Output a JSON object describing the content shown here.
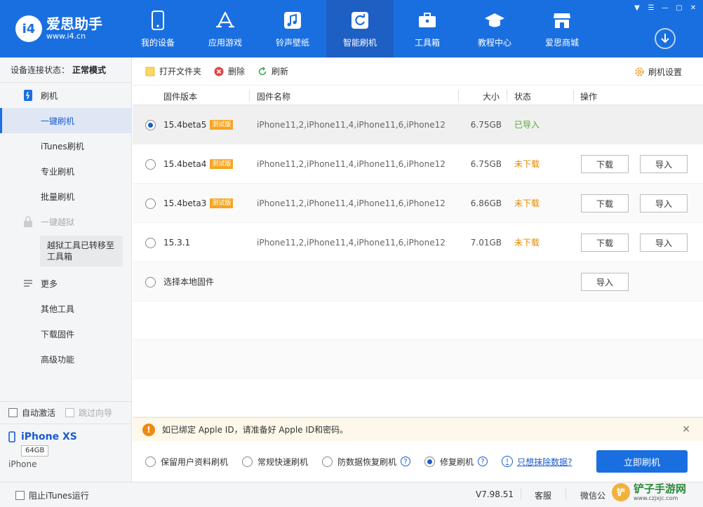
{
  "app": {
    "logo_mark": "i4",
    "logo_name": "爱思助手",
    "logo_url": "www.i4.cn"
  },
  "nav": [
    {
      "label": "我的设备",
      "icon": "phone-icon"
    },
    {
      "label": "应用游戏",
      "icon": "app-store-icon"
    },
    {
      "label": "铃声壁纸",
      "icon": "music-icon"
    },
    {
      "label": "智能刷机",
      "icon": "refresh-icon",
      "active": true
    },
    {
      "label": "工具箱",
      "icon": "toolbox-icon"
    },
    {
      "label": "教程中心",
      "icon": "graduation-cap-icon"
    },
    {
      "label": "爱思商城",
      "icon": "store-icon"
    }
  ],
  "sidebar": {
    "status_label": "设备连接状态：",
    "status_value": "正常模式",
    "flash_group": "刷机",
    "items": [
      "一键刷机",
      "iTunes刷机",
      "专业刷机",
      "批量刷机"
    ],
    "jailbreak_group": "一键越狱",
    "jailbreak_notice": "越狱工具已转移至工具箱",
    "more_group": "更多",
    "more_items": [
      "其他工具",
      "下载固件",
      "高级功能"
    ],
    "auto_activate": "自动激活",
    "skip_guide": "跳过向导",
    "device_name": "iPhone XS",
    "device_capacity": "64GB",
    "device_type": "iPhone"
  },
  "toolbar": {
    "open_folder": "打开文件夹",
    "delete": "删除",
    "refresh": "刷新",
    "settings": "刷机设置"
  },
  "table": {
    "headers": [
      "固件版本",
      "固件名称",
      "大小",
      "状态",
      "操作"
    ],
    "rows": [
      {
        "version": "15.4beta5",
        "tag": "测试版",
        "name": "iPhone11,2,iPhone11,4,iPhone11,6,iPhone12,...",
        "size": "6.75GB",
        "status": "已导入",
        "status_type": "ok",
        "selected": true
      },
      {
        "version": "15.4beta4",
        "tag": "测试版",
        "name": "iPhone11,2,iPhone11,4,iPhone11,6,iPhone12,...",
        "size": "6.75GB",
        "status": "未下载",
        "status_type": "nd"
      },
      {
        "version": "15.4beta3",
        "tag": "测试版",
        "name": "iPhone11,2,iPhone11,4,iPhone11,6,iPhone12,...",
        "size": "6.86GB",
        "status": "未下载",
        "status_type": "nd"
      },
      {
        "version": "15.3.1",
        "tag": "",
        "name": "iPhone11,2,iPhone11,4,iPhone11,6,iPhone12,...",
        "size": "7.01GB",
        "status": "未下载",
        "status_type": "nd"
      }
    ],
    "download_label": "下载",
    "import_label": "导入",
    "local_label": "选择本地固件"
  },
  "notice": {
    "text": "如已绑定 Apple ID，请准备好 Apple ID和密码。",
    "close": "×"
  },
  "modes": {
    "options": [
      "保留用户资料刷机",
      "常规快速刷机",
      "防数据恢复刷机",
      "修复刷机"
    ],
    "selected_index": 3,
    "erase_link": "只想抹除数据?",
    "flash_button": "立即刷机"
  },
  "statusbar": {
    "block_itunes": "阻止iTunes运行",
    "version": "V7.98.51",
    "service": "客服",
    "wechat": "微信公"
  },
  "watermark": {
    "text": "铲子手游网",
    "url": "www.czjxjc.com"
  },
  "colors": {
    "brand_blue": "#1a6fe0",
    "ok_green": "#52a934",
    "warn_orange": "#e68a00",
    "tag_orange": "#f5a623"
  }
}
